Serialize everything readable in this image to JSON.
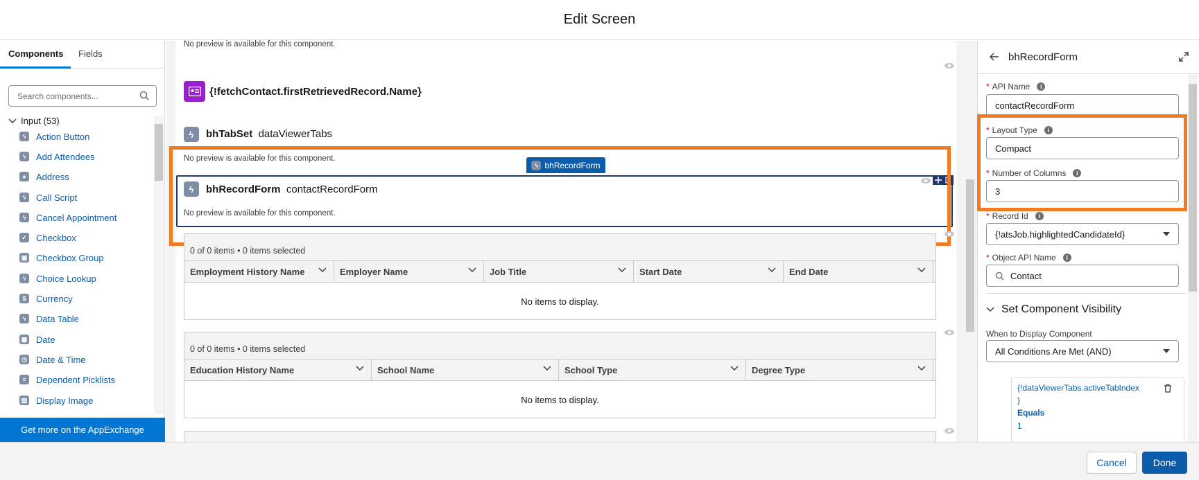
{
  "header": {
    "title": "Edit Screen"
  },
  "left_panel": {
    "tabs": [
      {
        "label": "Components"
      },
      {
        "label": "Fields"
      }
    ],
    "search": {
      "placeholder": "Search components..."
    },
    "group": {
      "label": "Input (53)"
    },
    "items": [
      {
        "label": "Action Button",
        "icon": "lightning-icon"
      },
      {
        "label": "Add Attendees",
        "icon": "lightning-icon"
      },
      {
        "label": "Address",
        "icon": "location-icon"
      },
      {
        "label": "Call Script",
        "icon": "lightning-icon"
      },
      {
        "label": "Cancel Appointment",
        "icon": "lightning-icon"
      },
      {
        "label": "Checkbox",
        "icon": "checkbox-icon"
      },
      {
        "label": "Checkbox Group",
        "icon": "checkbox-group-icon"
      },
      {
        "label": "Choice Lookup",
        "icon": "lightning-icon"
      },
      {
        "label": "Currency",
        "icon": "currency-icon"
      },
      {
        "label": "Data Table",
        "icon": "lightning-icon"
      },
      {
        "label": "Date",
        "icon": "date-icon"
      },
      {
        "label": "Date & Time",
        "icon": "datetime-icon"
      },
      {
        "label": "Dependent Picklists",
        "icon": "picklist-icon"
      },
      {
        "label": "Display Image",
        "icon": "image-icon"
      }
    ],
    "appexchange_label": "Get more on the AppExchange"
  },
  "canvas": {
    "no_preview_text": "No preview is available for this component.",
    "contact_name_title": "{!fetchContact.firstRetrievedRecord.Name}",
    "tabset": {
      "type": "bhTabSet",
      "name": "dataViewerTabs"
    },
    "selected_label": "bhRecordForm",
    "record_form": {
      "type": "bhRecordForm",
      "name": "contactRecordForm"
    },
    "employment_table": {
      "status": "0 of 0 items • 0 items selected",
      "columns": [
        "Employment History Name",
        "Employer Name",
        "Job Title",
        "Start Date",
        "End Date"
      ],
      "empty": "No items to display."
    },
    "education_table": {
      "status": "0 of 0 items • 0 items selected",
      "columns": [
        "Education History Name",
        "School Name",
        "School Type",
        "Degree Type"
      ],
      "empty": "No items to display."
    }
  },
  "right_panel": {
    "title": "bhRecordForm",
    "api_name": {
      "label": "API Name",
      "value": "contactRecordForm"
    },
    "layout_type": {
      "label": "Layout Type",
      "value": "Compact"
    },
    "number_of_columns": {
      "label": "Number of Columns",
      "value": "3"
    },
    "record_id": {
      "label": "Record Id",
      "value": "{!atsJob.highlightedCandidateId}"
    },
    "object_api_name": {
      "label": "Object API Name",
      "value": "Contact"
    },
    "visibility_section": "Set Component Visibility",
    "when_to_display": {
      "label": "When to Display Component",
      "value": "All Conditions Are Met (AND)"
    },
    "condition": {
      "resource_line1": "{!dataViewerTabs.activeTabIndex",
      "resource_line2": "}",
      "operator": "Equals",
      "value": "1"
    }
  },
  "footer": {
    "cancel_label": "Cancel",
    "done_label": "Done"
  },
  "colors": {
    "brand": "#0b5cab",
    "highlight": "#ef7b22",
    "selection": "#1b3a6b",
    "purple_icon": "#9b1fd1"
  }
}
